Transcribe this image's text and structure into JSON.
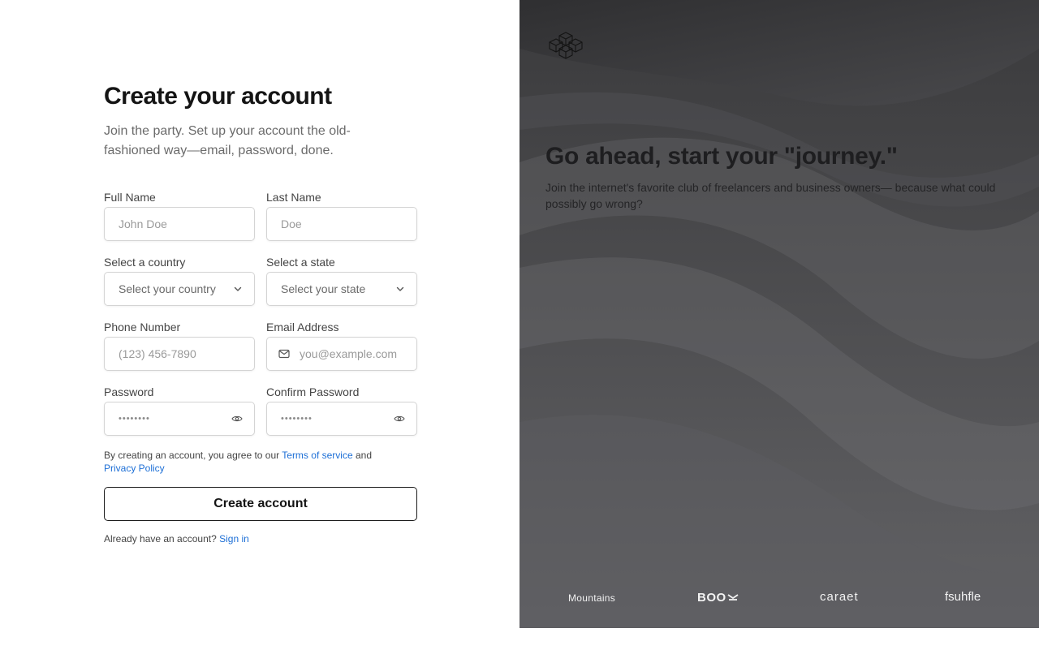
{
  "form": {
    "title": "Create your account",
    "subtitle": "Join the party. Set up your account the old-fashioned way—email, password, done.",
    "fields": {
      "full_name": {
        "label": "Full Name",
        "placeholder": "John Doe"
      },
      "last_name": {
        "label": "Last Name",
        "placeholder": "Doe"
      },
      "country": {
        "label": "Select a country",
        "placeholder": "Select your country"
      },
      "state": {
        "label": "Select a state",
        "placeholder": "Select your state"
      },
      "phone": {
        "label": "Phone Number",
        "placeholder": "(123) 456-7890"
      },
      "email": {
        "label": "Email Address",
        "placeholder": "you@example.com"
      },
      "password": {
        "label": "Password",
        "placeholder": "••••••••"
      },
      "confirm_password": {
        "label": "Confirm Password",
        "placeholder": "••••••••"
      }
    },
    "terms_prefix": "By creating an account, you agree to our",
    "terms_link": "Terms of service",
    "terms_and": "and",
    "privacy_link": "Privacy Policy",
    "submit_label": "Create account",
    "signin_prompt": "Already have an account?",
    "signin_link": "Sign in"
  },
  "hero": {
    "title": "Go ahead, start your \"journey.\"",
    "text": "Join the internet's favorite club of freelancers and business owners— because what could possibly go wrong?",
    "brands": [
      "Mountains",
      "BOO",
      "caraet",
      "fsuhfle"
    ]
  },
  "icons": {
    "logo": "cubes-logo-icon",
    "select": "chevron-down-icon",
    "email": "mail-icon",
    "password": "eye-icon"
  },
  "colors": {
    "link": "#1d6fd6",
    "panel_bg": "#5a5a5c",
    "text_dark": "#141414"
  }
}
